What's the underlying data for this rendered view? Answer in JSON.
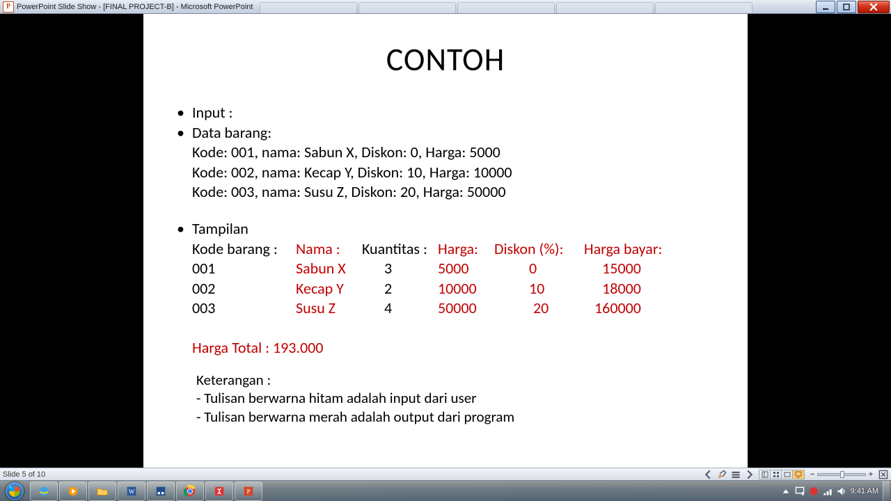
{
  "window": {
    "title": "PowerPoint Slide Show - [FINAL PROJECT-B] - Microsoft PowerPoint"
  },
  "slide": {
    "title": "CONTOH",
    "bullet_input": "Input :",
    "bullet_data": "Data barang:",
    "data_lines": [
      "Kode: 001,   nama: Sabun X, Diskon: 0, Harga: 5000",
      "Kode: 002,   nama: Kecap Y,  Diskon: 10, Harga: 10000",
      "Kode: 003,   nama: Susu Z, Diskon: 20, Harga: 50000"
    ],
    "bullet_tampilan": "Tampilan",
    "headers": {
      "kode": "Kode barang :",
      "nama": "Nama :",
      "qty": "Kuantitas :",
      "harga": "Harga:",
      "diskon": "Diskon (%):",
      "bayar": "Harga bayar:"
    },
    "rows": [
      {
        "kode": "001",
        "nama": "Sabun X",
        "qty": "3",
        "harga": "5000",
        "diskon": "0",
        "bayar": "15000"
      },
      {
        "kode": "002",
        "nama": "Kecap Y",
        "qty": "2",
        "harga": "10000",
        "diskon": "10",
        "bayar": "18000"
      },
      {
        "kode": "003",
        "nama": "Susu Z",
        "qty": "4",
        "harga": "50000",
        "diskon": "20",
        "bayar": "160000"
      }
    ],
    "total": "Harga Total  : 193.000",
    "keterangan_h": "Keterangan :",
    "ket1": "- Tulisan berwarna hitam adalah input dari user",
    "ket2": "- Tulisan berwarna merah adalah output dari program"
  },
  "status": {
    "slide_of": "Slide 5 of 10"
  },
  "tray": {
    "time": "9:41 AM"
  },
  "colors": {
    "output_red": "#c00000"
  }
}
